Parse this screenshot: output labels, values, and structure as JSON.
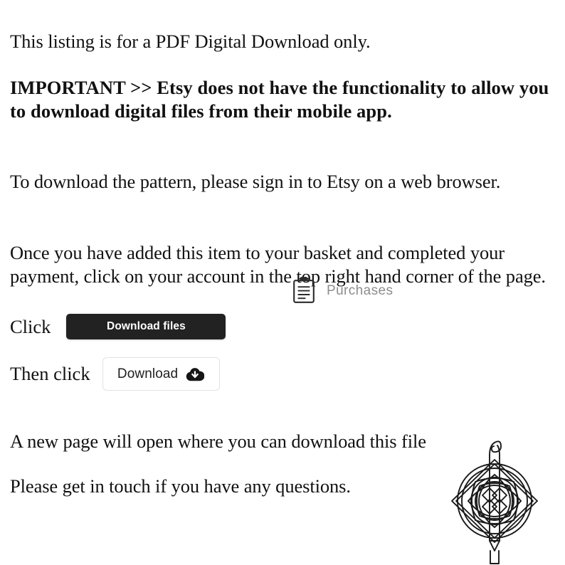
{
  "document": {
    "title": "PDF Digital Download instructions",
    "background_color": "#ffffff",
    "text_color": "#111111"
  },
  "paragraphs": {
    "intro": "This listing is for a PDF Digital Download only.",
    "important": "IMPORTANT >>  Etsy does not have the functionality to allow you to download digital files from their mobile app.",
    "browser": "To download the pattern, please sign in to Etsy on a web browser.",
    "once": "Once you have added this item to your basket and completed your payment,  click on your account in the top right hand corner of the page.",
    "new_page": "A new page will open where you can download this file",
    "get_in_touch": "Please get in touch if you have any questions."
  },
  "purchases": {
    "icon": "clipboard-icon",
    "label": "Purchases",
    "label_color": "#8d8d8d"
  },
  "steps": {
    "click_label": "Click",
    "then_click_label": "Then click"
  },
  "buttons": {
    "download_files": {
      "label": "Download files",
      "background_color": "#222222",
      "text_color": "#ffffff"
    },
    "download": {
      "label": "Download",
      "icon": "cloud-download-icon",
      "background_color": "#ffffff",
      "border_color": "#e2e2e2",
      "text_color": "#202020"
    }
  },
  "logo": {
    "name": "celtic-knot-crochet-hook-logo",
    "stroke_color": "#1a1a1a"
  }
}
